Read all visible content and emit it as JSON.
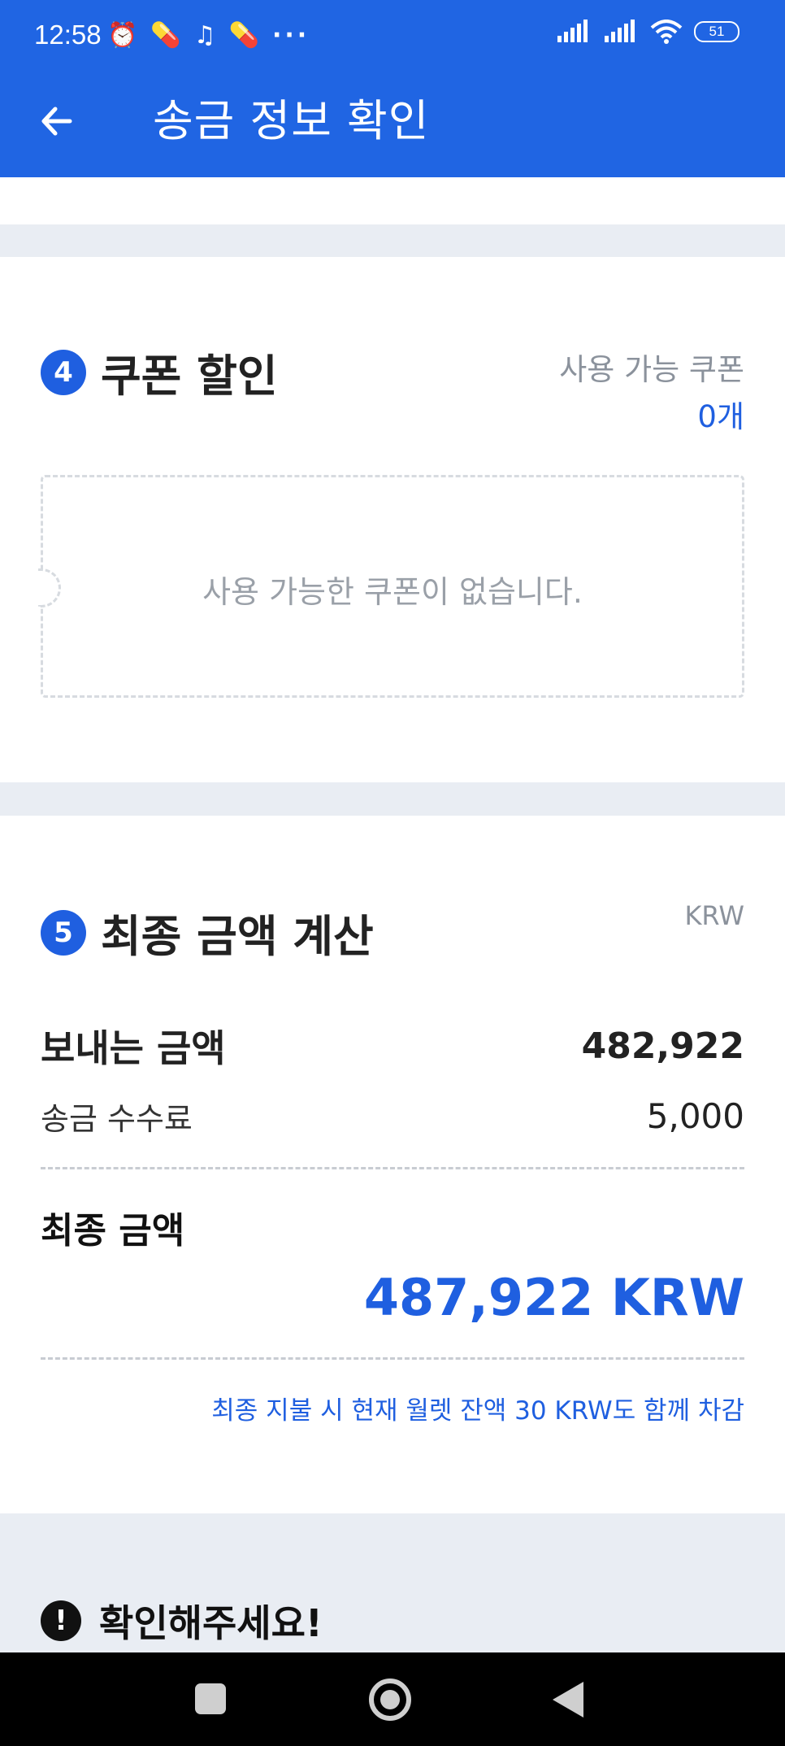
{
  "status_bar": {
    "time": "12:58",
    "battery": "51",
    "more": "···"
  },
  "header": {
    "title": "송금 정보 확인"
  },
  "coupon_section": {
    "number": "4",
    "title": "쿠폰 할인",
    "available_label": "사용 가능 쿠폰",
    "available_count": "0개",
    "empty_message": "사용 가능한 쿠폰이 없습니다."
  },
  "calc_section": {
    "number": "5",
    "title": "최종 금액 계산",
    "currency": "KRW",
    "send_label": "보내는 금액",
    "send_value": "482,922",
    "fee_label": "송금 수수료",
    "fee_value": "5,000",
    "final_label": "최종 금액",
    "final_value": "487,922 KRW",
    "wallet_note": "최종 지불 시 현재 월렛 잔액 30 KRW도 함께 차감"
  },
  "notice": {
    "icon": "!",
    "title": "확인해주세요!"
  },
  "colors": {
    "primary": "#2065e3",
    "accent_text": "#1f5fe0",
    "background": "#e9edf3"
  }
}
